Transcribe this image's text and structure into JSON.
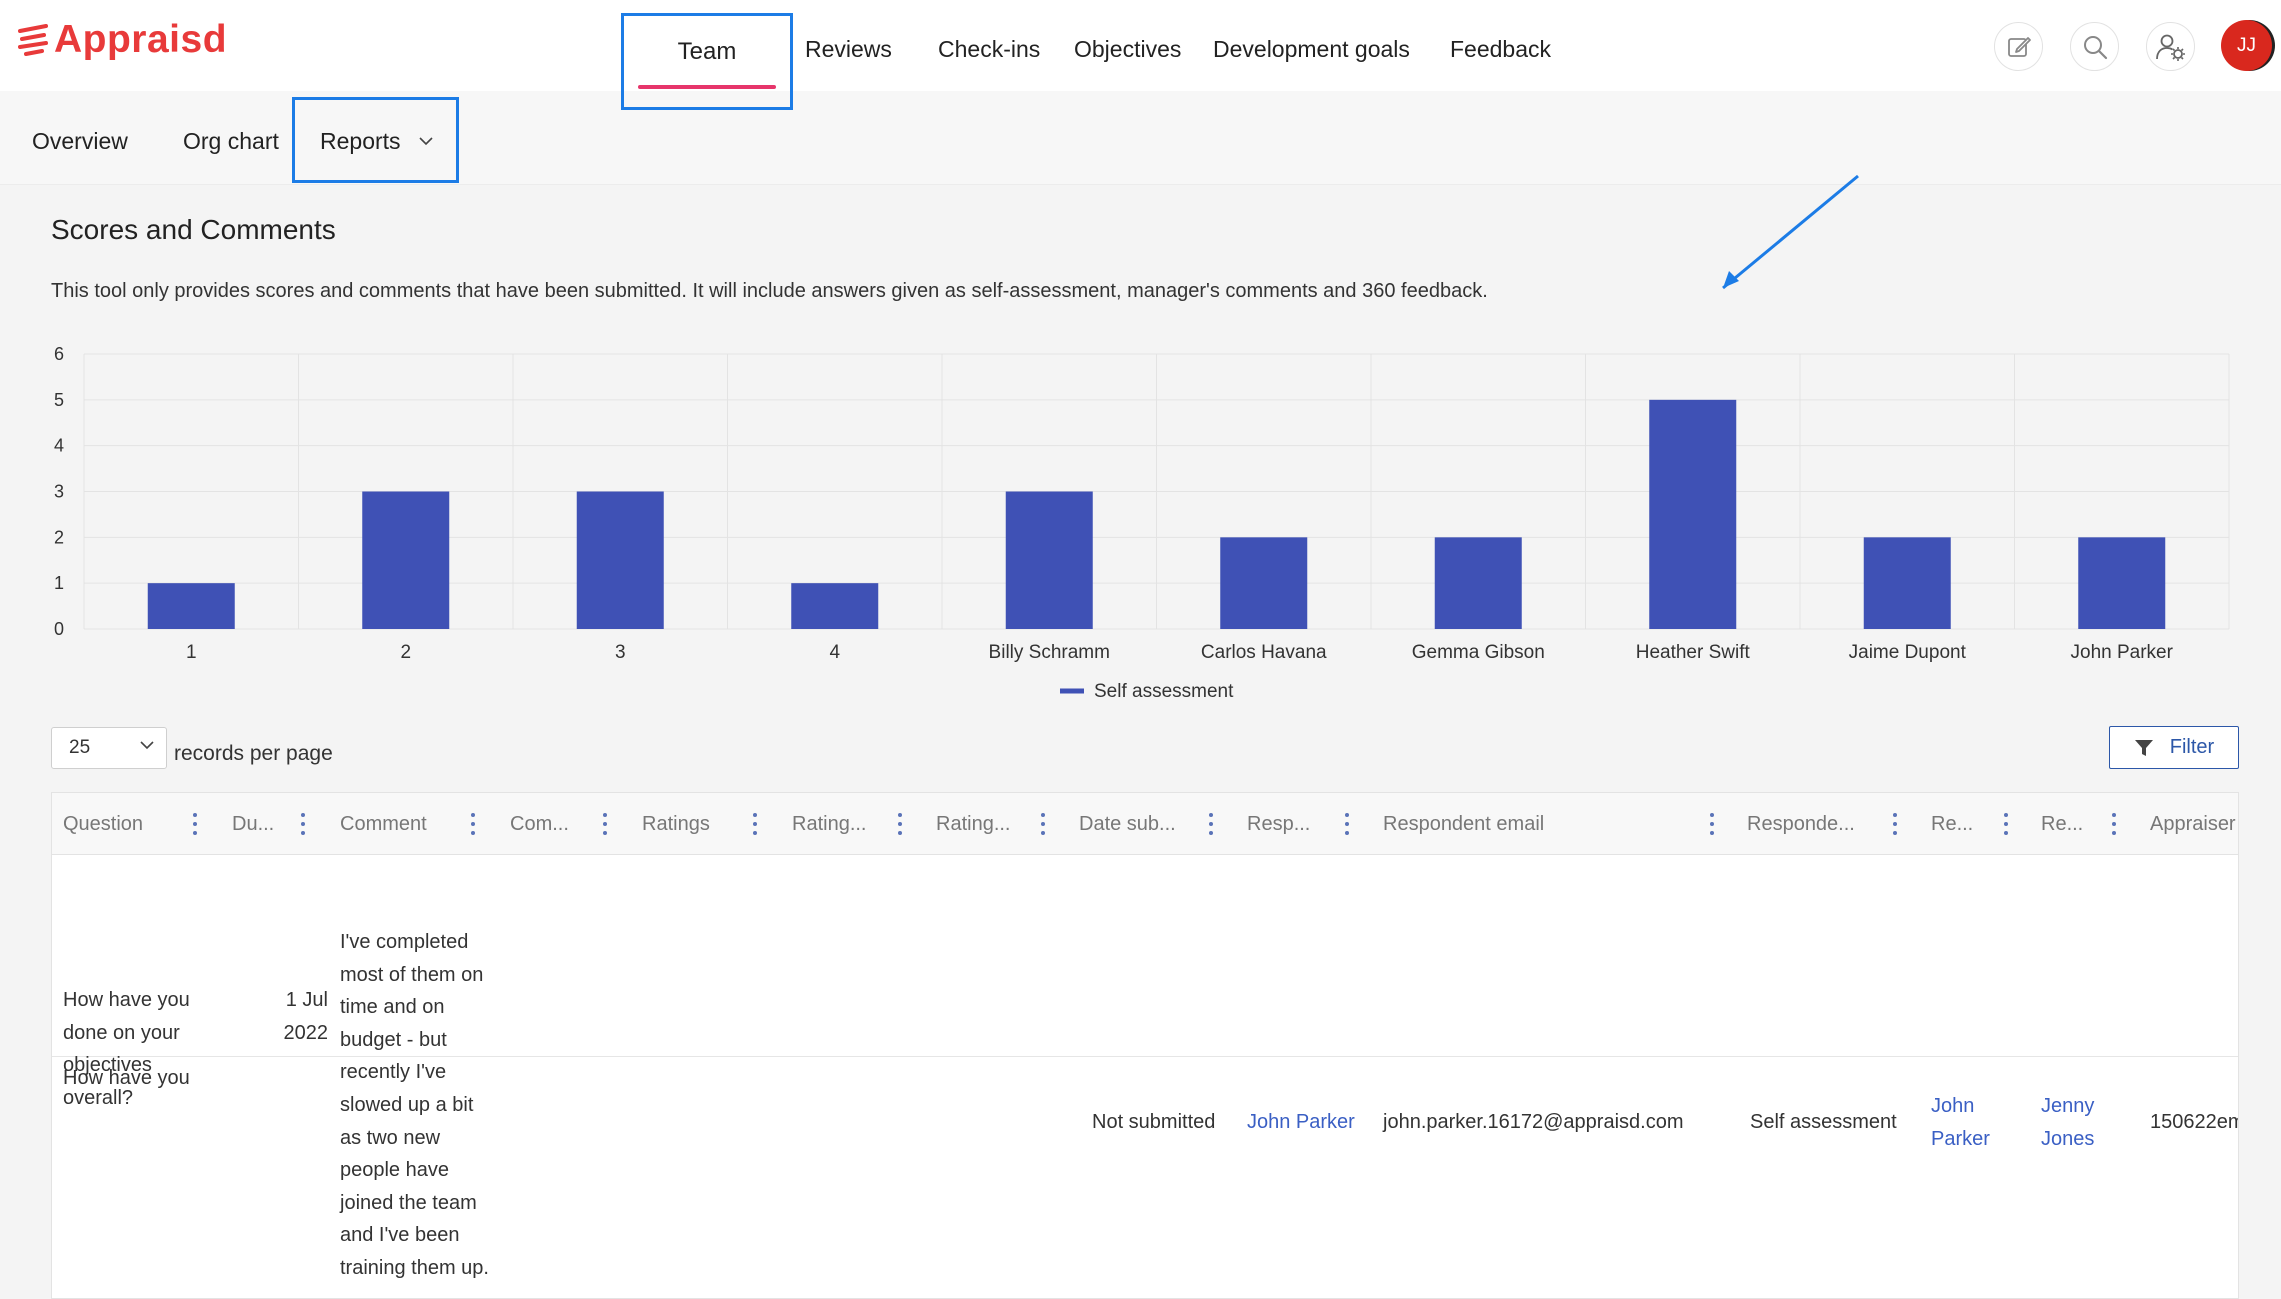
{
  "brand": {
    "logo_text": "Appraisd",
    "accent": "#e83a3a"
  },
  "nav": {
    "tabs": [
      {
        "label": "Team",
        "active": true
      },
      {
        "label": "Reviews"
      },
      {
        "label": "Check-ins"
      },
      {
        "label": "Objectives"
      },
      {
        "label": "Development goals"
      },
      {
        "label": "Feedback"
      }
    ],
    "icons": [
      "edit-icon",
      "search-icon",
      "user-settings-icon"
    ],
    "avatar_initials": "JJ"
  },
  "subnav": {
    "tabs": [
      {
        "label": "Overview"
      },
      {
        "label": "Org chart"
      },
      {
        "label": "Reports",
        "dropdown": true,
        "active": true
      }
    ]
  },
  "page": {
    "title": "Scores and Comments",
    "description": "This tool only provides scores and comments that have been submitted. It will include answers given as self-assessment, manager's comments and 360 feedback."
  },
  "chart_data": {
    "type": "bar",
    "categories": [
      "1",
      "2",
      "3",
      "4",
      "Billy Schramm",
      "Carlos Havana",
      "Gemma Gibson",
      "Heather Swift",
      "Jaime Dupont",
      "John Parker"
    ],
    "series": [
      {
        "name": "Self assessment",
        "values": [
          1,
          3,
          3,
          1,
          3,
          2,
          2,
          5,
          2,
          2
        ],
        "color": "#3f51b5"
      }
    ],
    "ylim": [
      0,
      6
    ],
    "yticks": [
      "0",
      "1",
      "2",
      "3",
      "4",
      "5",
      "6"
    ],
    "grid": true,
    "legend": "bottom-center"
  },
  "controls": {
    "per_page_value": "25",
    "per_page_label": "records per page",
    "filter_label": "Filter"
  },
  "table": {
    "columns": [
      "Question",
      "Du...",
      "Comment",
      "Com...",
      "Ratings",
      "Rating...",
      "Rating...",
      "Date sub...",
      "Resp...",
      "Respondent email",
      "Responde...",
      "Re...",
      "Re...",
      "Appraiser"
    ],
    "rows": [
      {
        "question": "How have you done on your objectives overall?",
        "due": "1 Jul 2022",
        "comment": "I've completed most of them on time and on budget - but recently I've slowed up a bit as two new people have joined the team and I've been training them up.",
        "date_submitted": "Not submitted",
        "respondent": "John Parker",
        "respondent_email": "john.parker.16172@appraisd.com",
        "respondent_type": "Self assessment",
        "reviewee": "John Parker",
        "reviewer": "Jenny Jones",
        "appraiser": "150622em"
      },
      {
        "question": "How have you"
      }
    ]
  }
}
